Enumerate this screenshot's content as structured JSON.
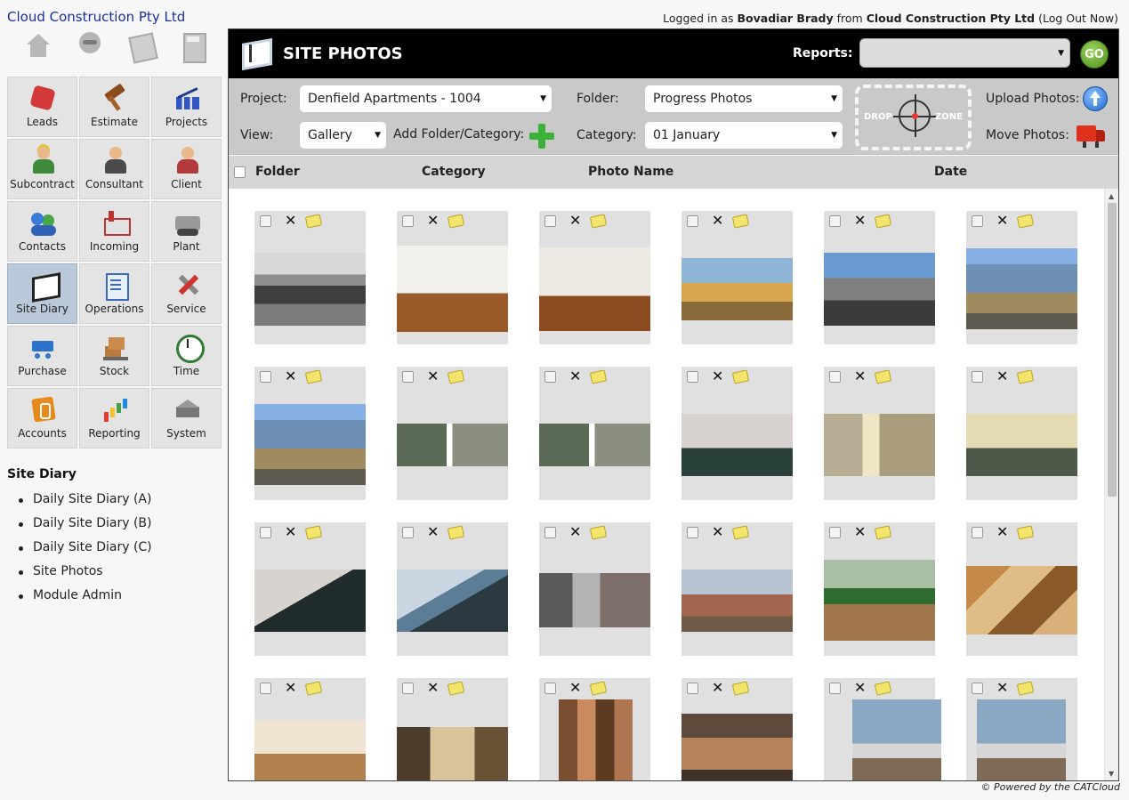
{
  "company": "Cloud Construction Pty Ltd",
  "user_bar": {
    "prefix": "Logged in as ",
    "user": "Bovadiar Brady",
    "from": " from ",
    "company": "Cloud Construction Pty Ltd",
    "logout": " (Log Out Now)"
  },
  "top_icons": [
    "home-icon",
    "user-icon",
    "document-icon",
    "calculator-icon"
  ],
  "tiles": [
    {
      "label": "Leads",
      "icon": "puzzle-icon"
    },
    {
      "label": "Estimate",
      "icon": "gavel-icon"
    },
    {
      "label": "Projects",
      "icon": "chart-icon"
    },
    {
      "label": "Subcontract",
      "icon": "worker-icon"
    },
    {
      "label": "Consultant",
      "icon": "consultant-icon"
    },
    {
      "label": "Client",
      "icon": "client-icon"
    },
    {
      "label": "Contacts",
      "icon": "contacts-icon"
    },
    {
      "label": "Incoming",
      "icon": "mailbox-icon"
    },
    {
      "label": "Plant",
      "icon": "truck-icon"
    },
    {
      "label": "Site Diary",
      "icon": "diary-icon",
      "active": true
    },
    {
      "label": "Operations",
      "icon": "checklist-icon"
    },
    {
      "label": "Service",
      "icon": "tools-icon"
    },
    {
      "label": "Purchase",
      "icon": "cart-icon"
    },
    {
      "label": "Stock",
      "icon": "boxes-icon"
    },
    {
      "label": "Time",
      "icon": "clock-icon"
    },
    {
      "label": "Accounts",
      "icon": "money-icon"
    },
    {
      "label": "Reporting",
      "icon": "bar-chart-icon"
    },
    {
      "label": "System",
      "icon": "crown-icon"
    }
  ],
  "module": {
    "title": "Site Diary",
    "links": [
      "Daily Site Diary (A)",
      "Daily Site Diary (B)",
      "Daily Site Diary (C)",
      "Site Photos",
      "Module Admin"
    ]
  },
  "page": {
    "title": "SITE PHOTOS",
    "reports_label": "Reports:",
    "reports_value": "",
    "go_label": "GO"
  },
  "filters": {
    "project_label": "Project:",
    "project_value": "Denfield Apartments - 1004",
    "view_label": "View:",
    "view_value": "Gallery",
    "add_folder_label": "Add Folder/Category:",
    "folder_label": "Folder:",
    "folder_value": "Progress Photos",
    "category_label": "Category:",
    "category_value": "01 January",
    "drop_text_left": "DROP",
    "drop_text_right": "ZONE",
    "upload_label": "Upload Photos:",
    "move_label": "Move Photos:"
  },
  "columns": [
    "Folder",
    "Category",
    "Photo Name",
    "Date"
  ],
  "photos": [
    {
      "style": "p-bw",
      "subject": "old-building-demolition"
    },
    {
      "style": "p-room",
      "subject": "empty-room-window"
    },
    {
      "style": "p-room2",
      "subject": "empty-room-door"
    },
    {
      "style": "p-crane",
      "subject": "building-crane"
    },
    {
      "style": "p-crane2",
      "subject": "construction-cranes"
    },
    {
      "style": "p-scaf",
      "subject": "scaffolded-building"
    },
    {
      "style": "p-scaf",
      "subject": "scaffolded-building"
    },
    {
      "style": "p-scaf2",
      "subject": "scaffold-panorama"
    },
    {
      "style": "p-scaf2",
      "subject": "scaffold-panorama"
    },
    {
      "style": "p-wall",
      "subject": "wall-carpet"
    },
    {
      "style": "p-corner",
      "subject": "door-frame-carpet"
    },
    {
      "style": "p-corner2",
      "subject": "door-frame-carpet"
    },
    {
      "style": "p-diag",
      "subject": "carpet-edge"
    },
    {
      "style": "p-window",
      "subject": "window-sill"
    },
    {
      "style": "p-worker",
      "subject": "electrician-worker"
    },
    {
      "style": "p-town",
      "subject": "site-overview"
    },
    {
      "style": "p-roof",
      "subject": "roof-truss-lift"
    },
    {
      "style": "p-truss",
      "subject": "roof-trusses"
    },
    {
      "style": "p-hall",
      "subject": "ornate-hall"
    },
    {
      "style": "p-door",
      "subject": "interior-doorway"
    },
    {
      "style": "p-pipes",
      "subject": "exposed-framing"
    },
    {
      "style": "p-copper",
      "subject": "copper-pipes"
    },
    {
      "style": "p-dome",
      "subject": "workers-on-dome"
    },
    {
      "style": "p-dome",
      "subject": "workers-on-dome"
    }
  ],
  "footer": "© Powered by the CATCloud"
}
